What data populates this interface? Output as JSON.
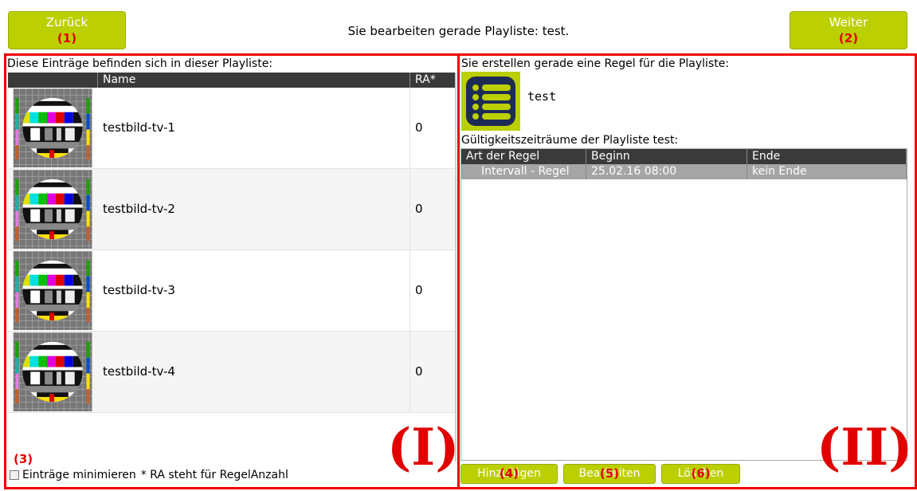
{
  "header": {
    "back": {
      "label": "Zurück",
      "marker": "(1)"
    },
    "next": {
      "label": "Weiter",
      "marker": "(2)"
    },
    "title": "Sie bearbeiten gerade Playliste: test."
  },
  "left_panel": {
    "caption": "Diese Einträge befinden sich in dieser Playliste:",
    "columns": [
      "",
      "Name",
      "RA*"
    ],
    "rows": [
      {
        "name": "testbild-tv-1",
        "ra": "0"
      },
      {
        "name": "testbild-tv-2",
        "ra": "0"
      },
      {
        "name": "testbild-tv-3",
        "ra": "0"
      },
      {
        "name": "testbild-tv-4",
        "ra": "0"
      }
    ],
    "marker": "(3)",
    "minimize_label": "Einträge minimieren",
    "footnote": "* RA steht für RegelAnzahl",
    "section_label": "(I)"
  },
  "right_panel": {
    "caption": "Sie erstellen gerade eine Regel für die Playliste:",
    "playlist_name": "test",
    "validity_caption": "Gültigkeitszeiträume der Playliste test:",
    "columns": [
      "Art der Regel",
      "Beginn",
      "Ende"
    ],
    "rows": [
      {
        "type": "Intervall - Regel",
        "start": "25.02.16 08:00",
        "end": "kein Ende"
      }
    ],
    "buttons": [
      {
        "label": "Hinzufügen",
        "marker": "(4)"
      },
      {
        "label": "Bearbeiten",
        "marker": "(5)"
      },
      {
        "label": "Löschen",
        "marker": "(6)"
      }
    ],
    "section_label": "(II)"
  },
  "colors": {
    "accent": "#bccf00",
    "annotation": "#e00000",
    "header_dark": "#3a3a3a"
  }
}
